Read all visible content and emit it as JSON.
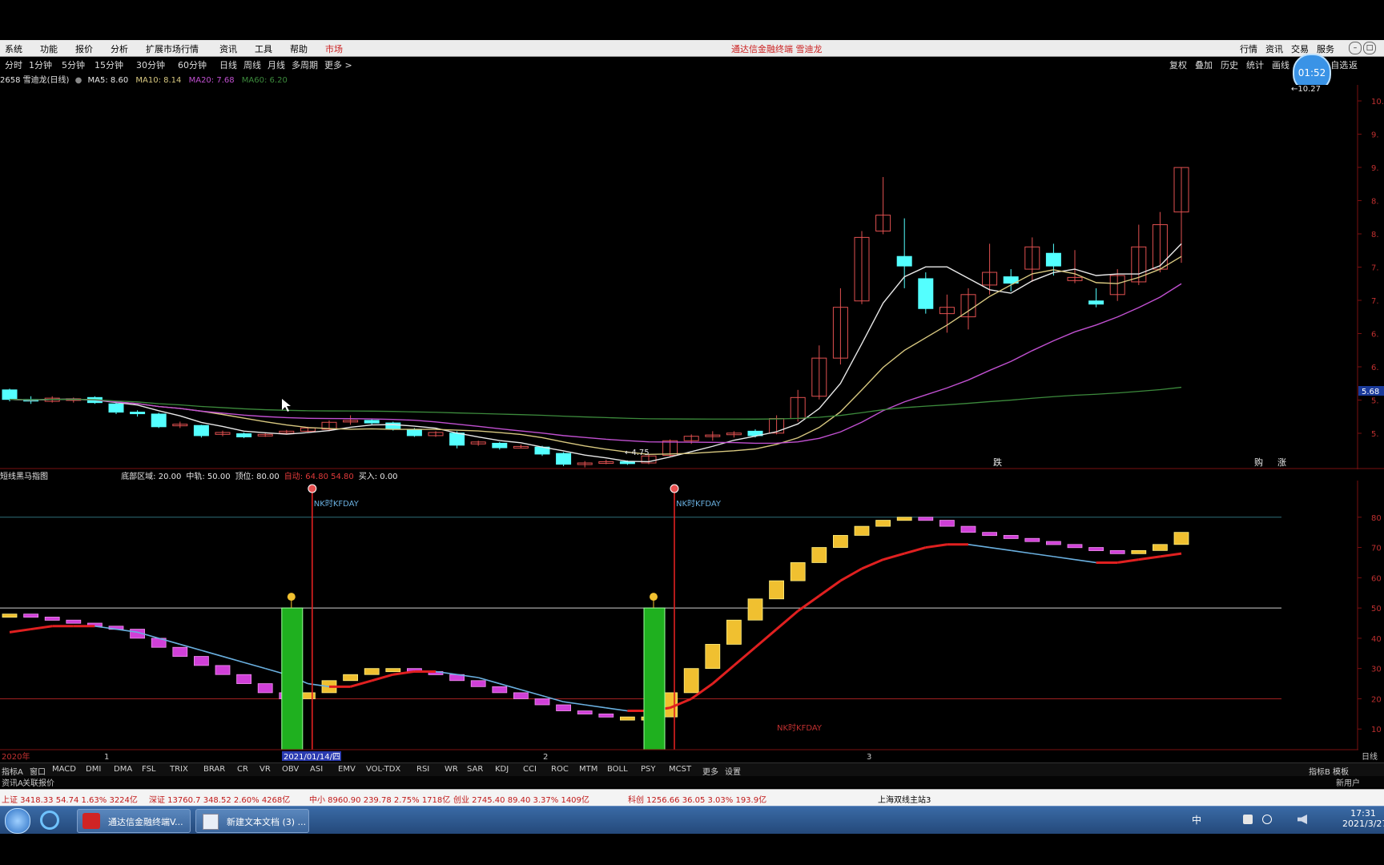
{
  "menu": {
    "items": [
      "系统",
      "功能",
      "报价",
      "分析",
      "扩展市场行情",
      "资讯",
      "工具",
      "帮助",
      "市场"
    ],
    "title": "通达信金融终端 雪迪龙",
    "right": [
      "行情",
      "资讯",
      "交易",
      "服务"
    ]
  },
  "toolbar": {
    "periods": [
      "分时",
      "1分钟",
      "5分钟",
      "15分钟",
      "30分钟",
      "60分钟",
      "日线",
      "周线",
      "月线",
      "多周期",
      "更多 >"
    ],
    "right": [
      "复权",
      "叠加",
      "历史",
      "统计",
      "画线",
      "标记",
      "+自选",
      "返"
    ]
  },
  "timer": "01:52",
  "stock": {
    "code_name": "2658 雪迪龙(日线)",
    "ma5": "MA5: 8.60",
    "ma10": "MA10: 8.14",
    "ma20": "MA20: 7.68",
    "ma60": "MA60: 6.20",
    "high_label": "10.27",
    "low_label": "4.75",
    "price_tag": "5.68",
    "markers": [
      "跌",
      "购",
      "涨"
    ]
  },
  "indicator": {
    "name": "短线黑马指图",
    "params": [
      {
        "label": "底部区域: 20.00",
        "color": "#e6e6e6"
      },
      {
        "label": "中轨: 50.00",
        "color": "#e6e6e6"
      },
      {
        "label": "顶位: 80.00",
        "color": "#e6e6e6"
      },
      {
        "label": "自动: 64.80 54.80",
        "color": "#e03a3a"
      },
      {
        "label": "买入: 0.00",
        "color": "#e6e6e6"
      }
    ],
    "signal1": "NK时KFDAY",
    "signal2": "NK时KFDAY",
    "signal3": "NK时KFDAY"
  },
  "axis": {
    "main_ticks": [
      "10.",
      "9.",
      "9.",
      "8.",
      "8.",
      "7.",
      "7.",
      "6.",
      "6.",
      "5.",
      "5."
    ],
    "sub_ticks": [
      "80",
      "70",
      "60",
      "50",
      "40",
      "30",
      "20",
      "10"
    ],
    "x_labels": [
      "2020年",
      "1",
      "2021/01/14/四",
      "2",
      "3"
    ],
    "corner": "日线"
  },
  "tabs": [
    "指标A",
    "窗口",
    "MACD",
    "DMI",
    "DMA",
    "FSL",
    "TRIX",
    "BRAR",
    "CR",
    "VR",
    "OBV",
    "ASI",
    "EMV",
    "VOL-TDX",
    "RSI",
    "WR",
    "SAR",
    "KDJ",
    "CCI",
    "ROC",
    "MTM",
    "BOLL",
    "PSY",
    "MCST",
    "更多",
    "设置"
  ],
  "tabs_right": [
    "指标B",
    "模板"
  ],
  "subtabs": [
    "资讯A",
    "关联报价"
  ],
  "subtabs_right": "新用户",
  "statusbar": {
    "items": [
      "上证 3418.33  54.74  1.63%  3224亿",
      "深证 13760.7  348.52  2.60%  4268亿",
      "中小 8960.90  239.78  2.75%  1718亿",
      "创业 2745.40  89.40  3.37%  1409亿",
      "科创 1256.66  36.05  3.03%  193.9亿",
      "上海双线主站3"
    ]
  },
  "taskbar": {
    "tasks": [
      "通达信金融终端V...",
      "新建文本文档 (3) ..."
    ],
    "tray": "中",
    "time": "17:31",
    "date": "2021/3/27"
  },
  "chart_data": [
    {
      "type": "candlestick",
      "title": "2658 雪迪龙(日线)",
      "ylim": [
        4.5,
        10.5
      ],
      "series": [
        {
          "name": "MA5",
          "color": "#e8e8e8"
        },
        {
          "name": "MA10",
          "color": "#d8c880"
        },
        {
          "name": "MA20",
          "color": "#c050d0"
        },
        {
          "name": "MA60",
          "color": "#3c8a3c"
        }
      ],
      "candles": [
        [
          5.7,
          5.55,
          5.72,
          5.52
        ],
        [
          5.55,
          5.53,
          5.6,
          5.48
        ],
        [
          5.52,
          5.57,
          5.6,
          5.5
        ],
        [
          5.55,
          5.56,
          5.58,
          5.5
        ],
        [
          5.58,
          5.5,
          5.6,
          5.48
        ],
        [
          5.48,
          5.35,
          5.5,
          5.32
        ],
        [
          5.35,
          5.33,
          5.38,
          5.28
        ],
        [
          5.32,
          5.12,
          5.34,
          5.1
        ],
        [
          5.14,
          5.16,
          5.2,
          5.1
        ],
        [
          5.14,
          4.98,
          5.15,
          4.95
        ],
        [
          5.0,
          5.03,
          5.06,
          4.97
        ],
        [
          5.01,
          4.96,
          5.03,
          4.94
        ],
        [
          4.98,
          5.0,
          5.02,
          4.96
        ],
        [
          5.02,
          5.05,
          5.07,
          5.0
        ],
        [
          5.05,
          5.1,
          5.12,
          5.03
        ],
        [
          5.08,
          5.19,
          5.22,
          5.05
        ],
        [
          5.2,
          5.22,
          5.3,
          5.15
        ],
        [
          5.22,
          5.18,
          5.25,
          5.15
        ],
        [
          5.18,
          5.08,
          5.2,
          5.06
        ],
        [
          5.08,
          4.98,
          5.1,
          4.96
        ],
        [
          4.98,
          5.03,
          5.05,
          4.96
        ],
        [
          5.02,
          4.83,
          5.05,
          4.78
        ],
        [
          4.85,
          4.88,
          4.9,
          4.82
        ],
        [
          4.86,
          4.79,
          4.88,
          4.76
        ],
        [
          4.8,
          4.81,
          4.84,
          4.78
        ],
        [
          4.8,
          4.69,
          4.82,
          4.66
        ],
        [
          4.7,
          4.53,
          4.72,
          4.5
        ],
        [
          4.54,
          4.55,
          4.58,
          4.48
        ],
        [
          4.56,
          4.57,
          4.6,
          4.53
        ],
        [
          4.57,
          4.54,
          4.59,
          4.52
        ],
        [
          4.55,
          4.66,
          4.68,
          4.53
        ],
        [
          4.67,
          4.9,
          4.92,
          4.64
        ],
        [
          4.9,
          4.97,
          5.0,
          4.85
        ],
        [
          4.98,
          4.99,
          5.05,
          4.9
        ],
        [
          5.0,
          5.02,
          5.05,
          4.95
        ],
        [
          5.05,
          4.98,
          5.08,
          4.95
        ],
        [
          5.02,
          5.25,
          5.3,
          5.0
        ],
        [
          5.25,
          5.58,
          5.7,
          5.2
        ],
        [
          5.6,
          6.2,
          6.4,
          5.55
        ],
        [
          6.2,
          7.0,
          7.3,
          6.1
        ],
        [
          7.1,
          8.1,
          8.2,
          7.05
        ],
        [
          8.2,
          8.45,
          9.05,
          8.15
        ],
        [
          7.8,
          7.65,
          8.4,
          7.3
        ],
        [
          7.45,
          6.98,
          7.55,
          6.9
        ],
        [
          6.9,
          7.0,
          7.2,
          6.6
        ],
        [
          6.85,
          7.2,
          7.3,
          6.65
        ],
        [
          7.35,
          7.55,
          8.0,
          7.2
        ],
        [
          7.48,
          7.38,
          7.6,
          7.25
        ],
        [
          7.6,
          7.95,
          8.1,
          7.4
        ],
        [
          7.85,
          7.65,
          8.0,
          7.5
        ],
        [
          7.42,
          7.47,
          7.9,
          7.38
        ],
        [
          7.1,
          7.05,
          7.3,
          7.0
        ],
        [
          7.2,
          7.5,
          7.6,
          7.1
        ],
        [
          7.4,
          7.95,
          8.3,
          7.35
        ],
        [
          7.6,
          8.3,
          8.5,
          7.55
        ],
        [
          8.5,
          9.2,
          9.2,
          7.7
        ]
      ]
    },
    {
      "type": "bar",
      "title": "短线黑马指图",
      "ylim": [
        0,
        90
      ],
      "values": [
        48,
        47,
        46,
        45,
        44,
        43,
        40,
        37,
        34,
        31,
        28,
        25,
        22,
        20,
        22,
        26,
        28,
        30,
        30,
        29,
        28,
        26,
        24,
        22,
        20,
        18,
        16,
        15,
        14,
        14,
        14,
        22,
        30,
        38,
        46,
        53,
        59,
        65,
        70,
        74,
        77,
        79,
        80,
        79,
        77,
        75,
        74,
        73,
        72,
        71,
        70,
        69,
        68,
        69,
        71,
        75
      ],
      "signal_line": [
        42,
        43,
        44,
        44,
        44,
        43,
        42,
        40,
        38,
        36,
        34,
        32,
        30,
        28,
        25,
        24,
        24,
        26,
        28,
        29,
        29,
        28,
        27,
        25,
        23,
        21,
        19,
        18,
        17,
        16,
        16,
        17,
        20,
        25,
        31,
        37,
        43,
        49,
        54,
        59,
        63,
        66,
        68,
        70,
        71,
        71,
        70,
        69,
        68,
        67,
        66,
        65,
        65,
        66,
        67,
        68
      ]
    }
  ]
}
